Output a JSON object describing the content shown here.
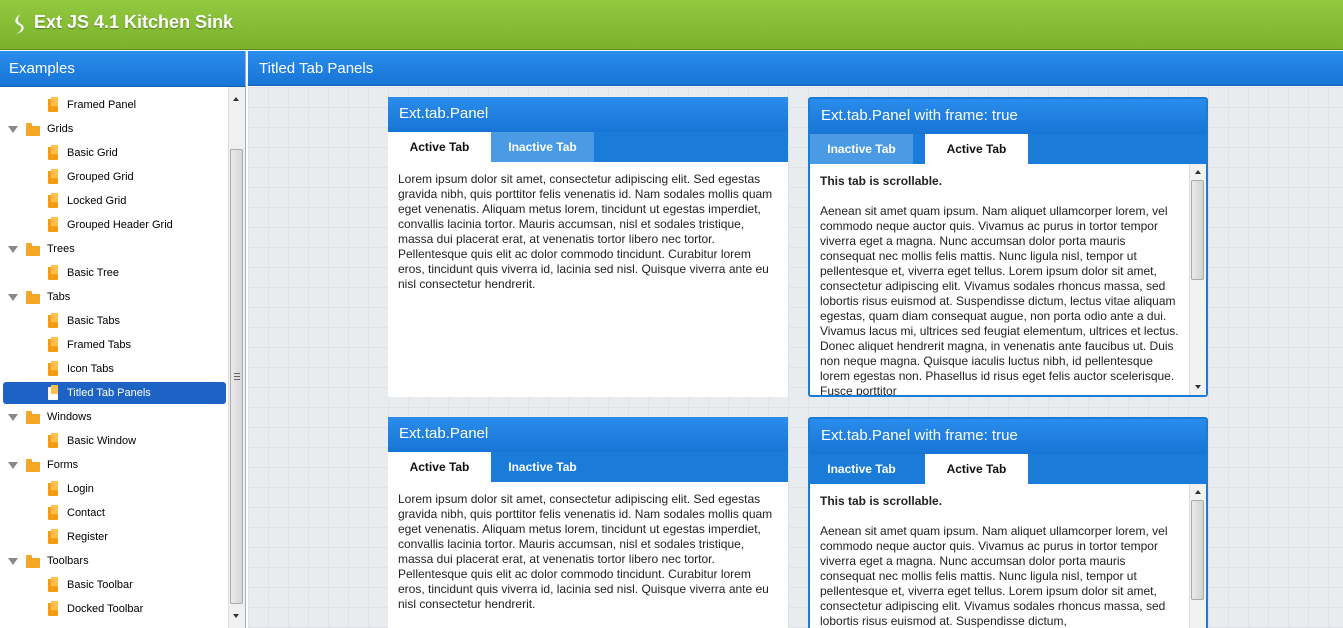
{
  "app": {
    "title": "Ext JS 4.1 Kitchen Sink",
    "logo_icon": "ext-logo-icon"
  },
  "sidebar": {
    "title": "Examples",
    "items": [
      {
        "label": "Framed Panel",
        "type": "leaf"
      },
      {
        "label": "Grids",
        "type": "folder"
      },
      {
        "label": "Basic Grid",
        "type": "leaf"
      },
      {
        "label": "Grouped Grid",
        "type": "leaf"
      },
      {
        "label": "Locked Grid",
        "type": "leaf"
      },
      {
        "label": "Grouped Header Grid",
        "type": "leaf"
      },
      {
        "label": "Trees",
        "type": "folder"
      },
      {
        "label": "Basic Tree",
        "type": "leaf"
      },
      {
        "label": "Tabs",
        "type": "folder"
      },
      {
        "label": "Basic Tabs",
        "type": "leaf"
      },
      {
        "label": "Framed Tabs",
        "type": "leaf"
      },
      {
        "label": "Icon Tabs",
        "type": "leaf"
      },
      {
        "label": "Titled Tab Panels",
        "type": "leaf",
        "selected": true
      },
      {
        "label": "Windows",
        "type": "folder"
      },
      {
        "label": "Basic Window",
        "type": "leaf"
      },
      {
        "label": "Forms",
        "type": "folder"
      },
      {
        "label": "Login",
        "type": "leaf"
      },
      {
        "label": "Contact",
        "type": "leaf"
      },
      {
        "label": "Register",
        "type": "leaf"
      },
      {
        "label": "Toolbars",
        "type": "folder"
      },
      {
        "label": "Basic Toolbar",
        "type": "leaf"
      },
      {
        "label": "Docked Toolbar",
        "type": "leaf"
      }
    ]
  },
  "main": {
    "title": "Titled Tab Panels",
    "panels": [
      {
        "title": "Ext.tab.Panel",
        "tabs": [
          "Active Tab",
          "Inactive Tab"
        ],
        "body": "Lorem ipsum dolor sit amet, consectetur adipiscing elit. Sed egestas gravida nibh, quis porttitor felis venenatis id. Nam sodales mollis quam eget venenatis. Aliquam metus lorem, tincidunt ut egestas imperdiet, convallis lacinia tortor. Mauris accumsan, nisl et sodales tristique, massa dui placerat erat, at venenatis tortor libero nec tortor. Pellentesque quis elit ac dolor commodo tincidunt. Curabitur lorem eros, tincidunt quis viverra id, lacinia sed nisl. Quisque viverra ante eu nisl consectetur hendrerit."
      },
      {
        "title": "Ext.tab.Panel with frame: true",
        "tabs": [
          "Inactive Tab",
          "Active Tab"
        ],
        "body_title": "This tab is scrollable.",
        "body": "Aenean sit amet quam ipsum. Nam aliquet ullamcorper lorem, vel commodo neque auctor quis. Vivamus ac purus in tortor tempor viverra eget a magna. Nunc accumsan dolor porta mauris consequat nec mollis felis mattis. Nunc ligula nisl, tempor ut pellentesque et, viverra eget tellus. Lorem ipsum dolor sit amet, consectetur adipiscing elit. Vivamus sodales rhoncus massa, sed lobortis risus euismod at. Suspendisse dictum, lectus vitae aliquam egestas, quam diam consequat augue, non porta odio ante a dui. Vivamus lacus mi, ultrices sed feugiat elementum, ultrices et lectus. Donec aliquet hendrerit magna, in venenatis ante faucibus ut. Duis non neque magna. Quisque iaculis luctus nibh, id pellentesque lorem egestas non. Phasellus id risus eget felis auctor scelerisque. Fusce porttitor"
      },
      {
        "title": "Ext.tab.Panel",
        "tabs": [
          "Active Tab",
          "Inactive Tab"
        ],
        "body": "Lorem ipsum dolor sit amet, consectetur adipiscing elit. Sed egestas gravida nibh, quis porttitor felis venenatis id. Nam sodales mollis quam eget venenatis. Aliquam metus lorem, tincidunt ut egestas imperdiet, convallis lacinia tortor. Mauris accumsan, nisl et sodales tristique, massa dui placerat erat, at venenatis tortor libero nec tortor. Pellentesque quis elit ac dolor commodo tincidunt. Curabitur lorem eros, tincidunt quis viverra id, lacinia sed nisl. Quisque viverra ante eu nisl consectetur hendrerit."
      },
      {
        "title": "Ext.tab.Panel with frame: true",
        "tabs": [
          "Inactive Tab",
          "Active Tab"
        ],
        "body_title": "This tab is scrollable.",
        "body": "Aenean sit amet quam ipsum. Nam aliquet ullamcorper lorem, vel commodo neque auctor quis. Vivamus ac purus in tortor tempor viverra eget a magna. Nunc accumsan dolor porta mauris consequat nec mollis felis mattis. Nunc ligula nisl, tempor ut pellentesque et, viverra eget tellus. Lorem ipsum dolor sit amet, consectetur adipiscing elit. Vivamus sodales rhoncus massa, sed lobortis risus euismod at. Suspendisse dictum,"
      }
    ]
  },
  "colors": {
    "header_green": "#86be35",
    "accent_blue": "#1b7bd9",
    "selected_blue": "#1d63c5",
    "folder_orange": "#f5a623"
  }
}
